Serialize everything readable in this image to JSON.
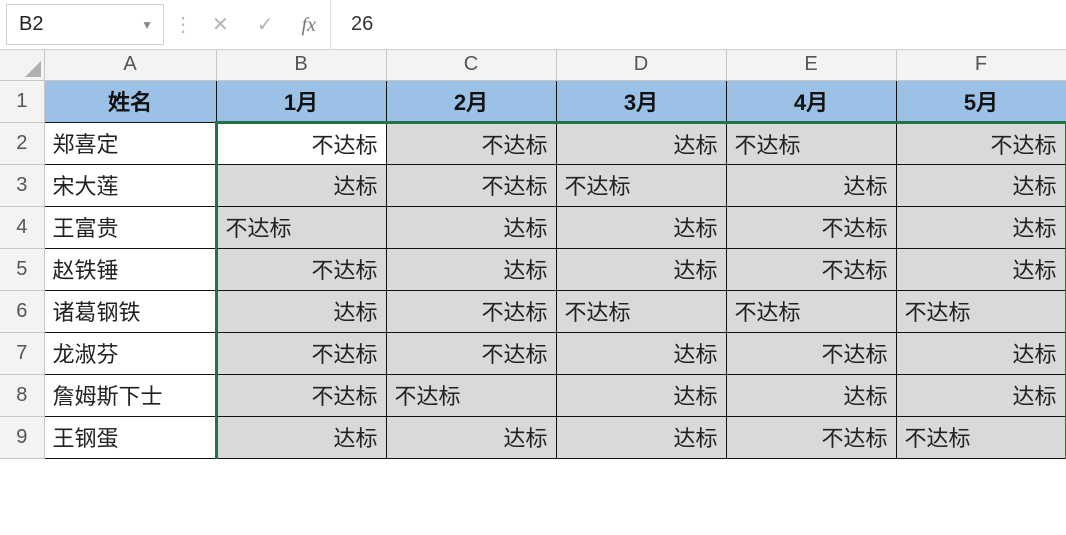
{
  "formula_bar": {
    "name_box": "B2",
    "cancel_glyph": "✕",
    "confirm_glyph": "✓",
    "fx_label": "fx",
    "formula_value": "26"
  },
  "columns": [
    "A",
    "B",
    "C",
    "D",
    "E",
    "F"
  ],
  "row_numbers": [
    "1",
    "2",
    "3",
    "4",
    "5",
    "6",
    "7",
    "8",
    "9"
  ],
  "header_row": {
    "A": "姓名",
    "B": "1月",
    "C": "2月",
    "D": "3月",
    "E": "4月",
    "F": "5月"
  },
  "rows": [
    {
      "name": "郑喜定",
      "b": {
        "text": "不达标",
        "align": "right"
      },
      "c": {
        "text": "不达标",
        "align": "right"
      },
      "d": {
        "text": "达标",
        "align": "right"
      },
      "e": {
        "text": "不达标",
        "align": "left"
      },
      "f": {
        "text": "不达标",
        "align": "right"
      }
    },
    {
      "name": "宋大莲",
      "b": {
        "text": "达标",
        "align": "right"
      },
      "c": {
        "text": "不达标",
        "align": "right"
      },
      "d": {
        "text": "不达标",
        "align": "left"
      },
      "e": {
        "text": "达标",
        "align": "right"
      },
      "f": {
        "text": "达标",
        "align": "right"
      }
    },
    {
      "name": "王富贵",
      "b": {
        "text": "不达标",
        "align": "left"
      },
      "c": {
        "text": "达标",
        "align": "right"
      },
      "d": {
        "text": "达标",
        "align": "right"
      },
      "e": {
        "text": "不达标",
        "align": "right"
      },
      "f": {
        "text": "达标",
        "align": "right"
      }
    },
    {
      "name": "赵铁锤",
      "b": {
        "text": "不达标",
        "align": "right"
      },
      "c": {
        "text": "达标",
        "align": "right"
      },
      "d": {
        "text": "达标",
        "align": "right"
      },
      "e": {
        "text": "不达标",
        "align": "right"
      },
      "f": {
        "text": "达标",
        "align": "right"
      }
    },
    {
      "name": "诸葛钢铁",
      "b": {
        "text": "达标",
        "align": "right"
      },
      "c": {
        "text": "不达标",
        "align": "right"
      },
      "d": {
        "text": "不达标",
        "align": "left"
      },
      "e": {
        "text": "不达标",
        "align": "left"
      },
      "f": {
        "text": "不达标",
        "align": "left"
      }
    },
    {
      "name": "龙淑芬",
      "b": {
        "text": "不达标",
        "align": "right"
      },
      "c": {
        "text": "不达标",
        "align": "right"
      },
      "d": {
        "text": "达标",
        "align": "right"
      },
      "e": {
        "text": "不达标",
        "align": "right"
      },
      "f": {
        "text": "达标",
        "align": "right"
      }
    },
    {
      "name": "詹姆斯下士",
      "b": {
        "text": "不达标",
        "align": "right"
      },
      "c": {
        "text": "不达标",
        "align": "left"
      },
      "d": {
        "text": "达标",
        "align": "right"
      },
      "e": {
        "text": "达标",
        "align": "right"
      },
      "f": {
        "text": "达标",
        "align": "right"
      }
    },
    {
      "name": "王钢蛋",
      "b": {
        "text": "达标",
        "align": "right"
      },
      "c": {
        "text": "达标",
        "align": "right"
      },
      "d": {
        "text": "达标",
        "align": "right"
      },
      "e": {
        "text": "不达标",
        "align": "right"
      },
      "f": {
        "text": "不达标",
        "align": "left"
      }
    }
  ],
  "active_cell": "B2"
}
